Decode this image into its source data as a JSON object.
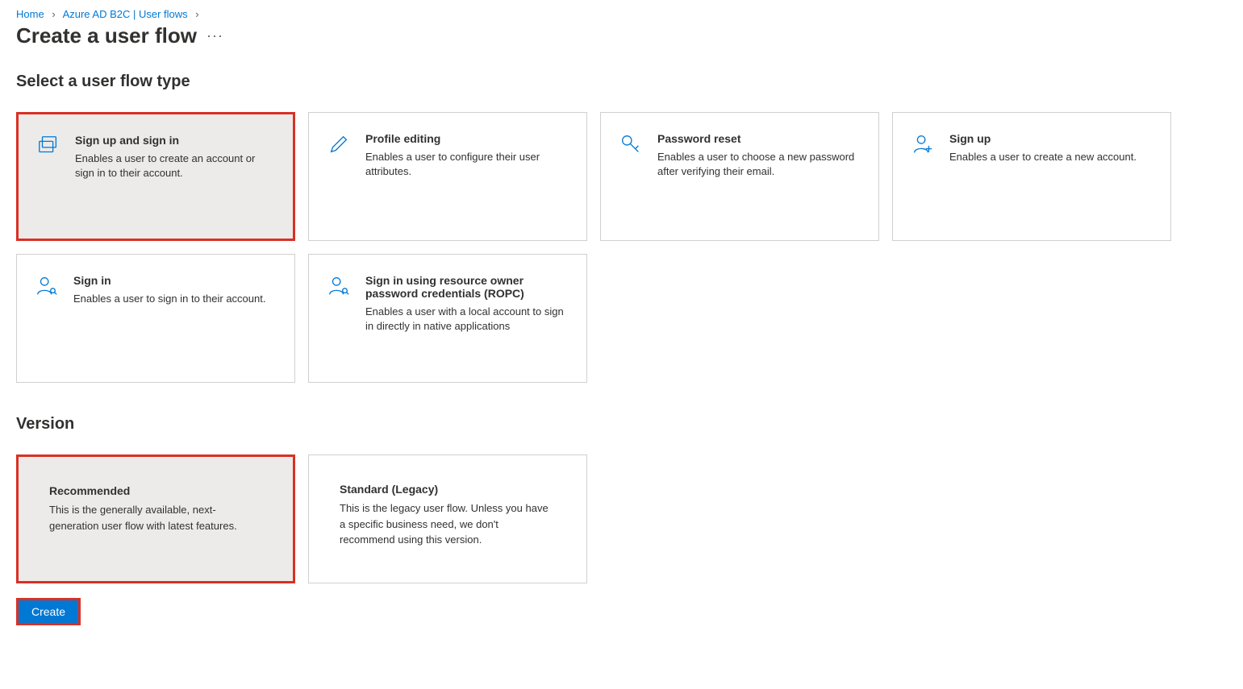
{
  "breadcrumb": {
    "home": "Home",
    "service": "Azure AD B2C | User flows"
  },
  "page_title": "Create a user flow",
  "section_type_title": "Select a user flow type",
  "flow_types": {
    "signup_signin": {
      "title": "Sign up and sign in",
      "desc": "Enables a user to create an account or sign in to their account."
    },
    "profile_editing": {
      "title": "Profile editing",
      "desc": "Enables a user to configure their user attributes."
    },
    "password_reset": {
      "title": "Password reset",
      "desc": "Enables a user to choose a new password after verifying their email."
    },
    "sign_up": {
      "title": "Sign up",
      "desc": "Enables a user to create a new account."
    },
    "sign_in": {
      "title": "Sign in",
      "desc": "Enables a user to sign in to their account."
    },
    "ropc": {
      "title": "Sign in using resource owner password credentials (ROPC)",
      "desc": "Enables a user with a local account to sign in directly in native applications"
    }
  },
  "section_version_title": "Version",
  "versions": {
    "recommended": {
      "title": "Recommended",
      "desc": "This is the generally available, next-generation user flow with latest features."
    },
    "standard": {
      "title": "Standard (Legacy)",
      "desc": "This is the legacy user flow. Unless you have a specific business need, we don't recommend using this version."
    }
  },
  "create_button": "Create"
}
